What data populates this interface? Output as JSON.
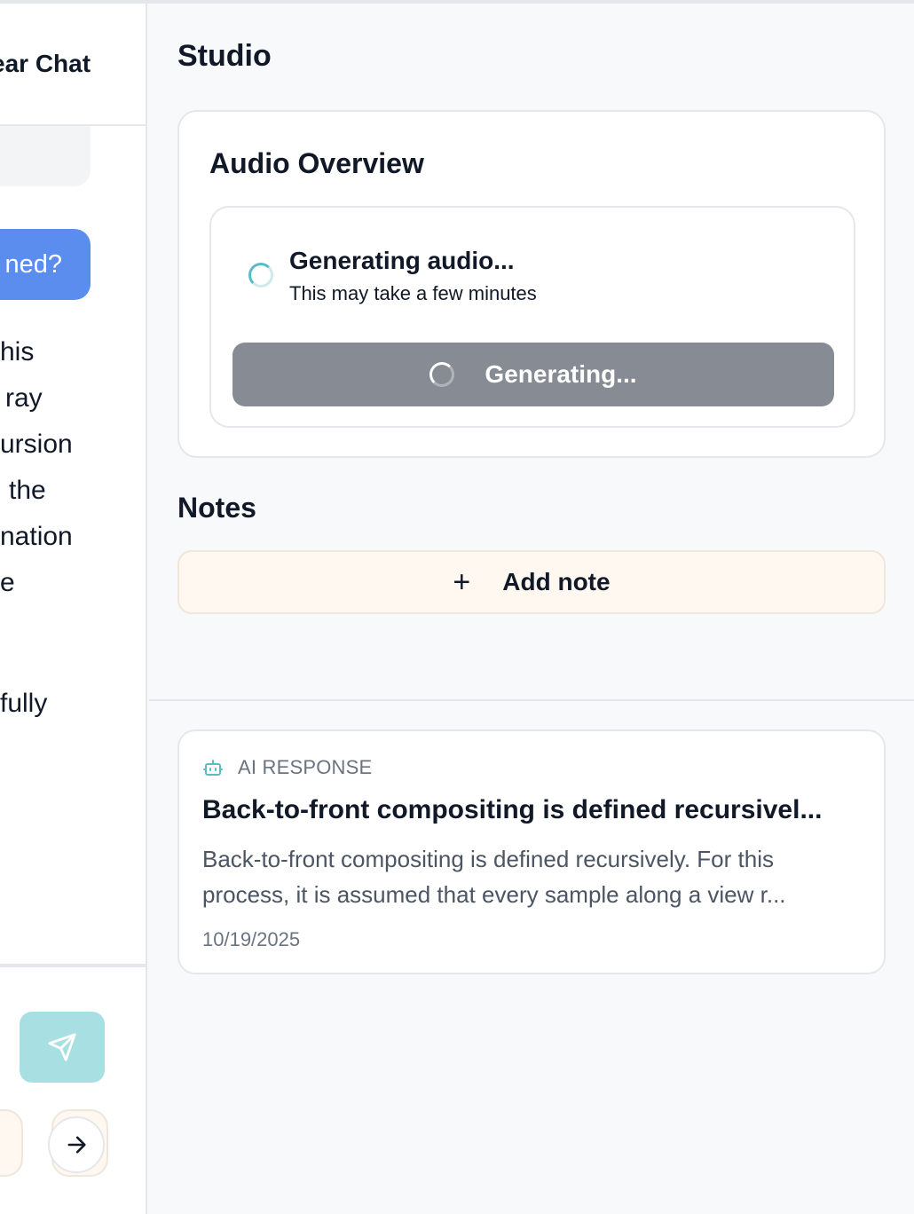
{
  "chat": {
    "clear_chat_label": "ear Chat",
    "user_message_fragment": "ned?",
    "response_lines": [
      "his",
      "ray",
      "ursion",
      "the",
      "nation",
      "e",
      "fully"
    ]
  },
  "studio": {
    "title": "Studio",
    "audio_overview": {
      "title": "Audio Overview",
      "status_title": "Generating audio...",
      "status_subtitle": "This may take a few minutes",
      "button_label": "Generating..."
    },
    "notes": {
      "title": "Notes",
      "add_note_label": "Add note",
      "items": [
        {
          "type": "AI RESPONSE",
          "title": "Back-to-front compositing is defined recursivel...",
          "preview_line1": "Back-to-front compositing is defined recursively. For this",
          "preview_line2": "process, it is assumed that every sample along a view r...",
          "date": "10/19/2025"
        }
      ]
    }
  },
  "icons": {
    "spinner": "spinner-icon",
    "plus": "plus-icon",
    "bot": "bot-icon",
    "send": "send-icon",
    "arrow_right": "arrow-right-icon"
  },
  "colors": {
    "accent_blue": "#5b8def",
    "teal": "#59bcc4",
    "send_button_teal": "#a8dfe2",
    "generating_gray": "#878b93",
    "note_cream": "#fff8f1"
  }
}
